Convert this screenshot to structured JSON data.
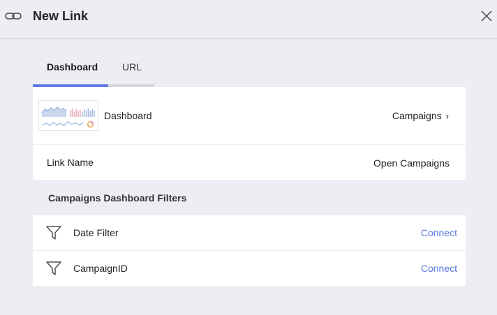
{
  "header": {
    "title": "New Link",
    "icon": "link-icon",
    "close_icon": "close-icon"
  },
  "tabs": [
    {
      "label": "Dashboard",
      "active": true
    },
    {
      "label": "URL",
      "active": false
    }
  ],
  "dashboard_card": {
    "label": "Dashboard",
    "selected_dashboard": "Campaigns",
    "chevron_icon": "chevron-right-icon",
    "thumbnail": "dashboard-thumbnail"
  },
  "link_name": {
    "label": "Link Name",
    "value": "Open Campaigns"
  },
  "filters_section": {
    "title": "Campaigns Dashboard Filters",
    "items": [
      {
        "label": "Date Filter",
        "action": "Connect",
        "icon": "filter-icon"
      },
      {
        "label": "CampaignID",
        "action": "Connect",
        "icon": "filter-icon"
      }
    ]
  },
  "colors": {
    "accent": "#6478e6",
    "link": "#5a78de",
    "background": "#edeef3"
  }
}
